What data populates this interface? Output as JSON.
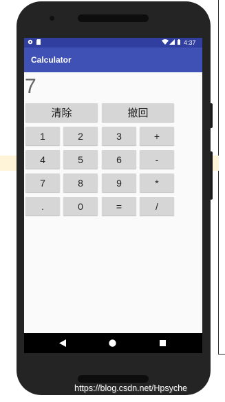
{
  "status_bar": {
    "time": "4:37",
    "icons": [
      "settings-icon",
      "sd-card-icon",
      "wifi-icon",
      "signal-icon",
      "battery-icon"
    ]
  },
  "app_bar": {
    "title": "Calculator"
  },
  "display": {
    "value": "7"
  },
  "buttons": {
    "clear": "清除",
    "undo": "撤回",
    "grid": [
      [
        "1",
        "2",
        "3",
        "+"
      ],
      [
        "4",
        "5",
        "6",
        "-"
      ],
      [
        "7",
        "8",
        "9",
        "*"
      ],
      [
        ".",
        "0",
        "=",
        "/"
      ]
    ]
  },
  "nav_bar": {
    "icons": [
      "back-icon",
      "home-icon",
      "recents-icon"
    ]
  },
  "watermark": "https://blog.csdn.net/Hpsyche",
  "colors": {
    "status_bar": "#303f9f",
    "app_bar": "#3f51b5",
    "button": "#d6d6d6",
    "background": "#fafafa"
  }
}
